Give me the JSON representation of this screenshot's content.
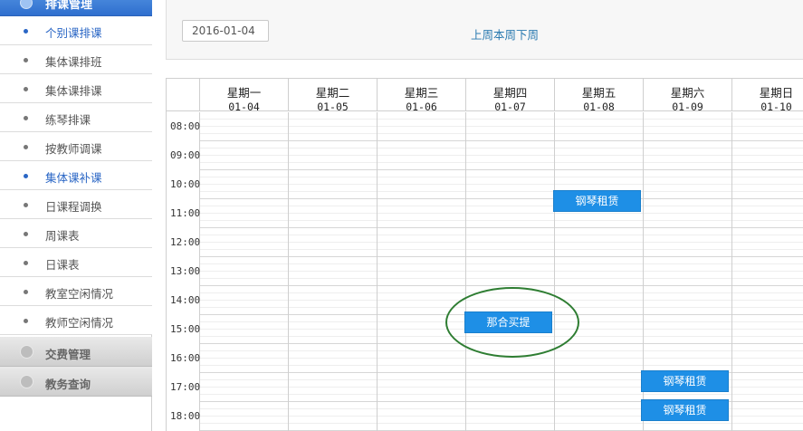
{
  "sidebar": {
    "active_group": "排课管理",
    "items": [
      {
        "label": "个别课排课",
        "color": "blue"
      },
      {
        "label": "集体课排班",
        "color": "gray"
      },
      {
        "label": "集体课排课",
        "color": "gray"
      },
      {
        "label": "练琴排课",
        "color": "gray"
      },
      {
        "label": "按教师调课",
        "color": "gray"
      },
      {
        "label": "集体课补课",
        "color": "blue"
      },
      {
        "label": "日课程调换",
        "color": "gray"
      },
      {
        "label": "周课表",
        "color": "gray"
      },
      {
        "label": "日课表",
        "color": "gray"
      },
      {
        "label": "教室空闲情况",
        "color": "gray"
      },
      {
        "label": "教师空闲情况",
        "color": "gray"
      }
    ],
    "sections": [
      {
        "label": "交费管理"
      },
      {
        "label": "教务查询"
      }
    ]
  },
  "toolbar": {
    "date_value": "2016-01-04",
    "nav_prev": "上周",
    "nav_current": "本周",
    "nav_next": "下周"
  },
  "calendar": {
    "days": [
      {
        "weekday": "星期一",
        "date": "01-04"
      },
      {
        "weekday": "星期二",
        "date": "01-05"
      },
      {
        "weekday": "星期三",
        "date": "01-06"
      },
      {
        "weekday": "星期四",
        "date": "01-07"
      },
      {
        "weekday": "星期五",
        "date": "01-08"
      },
      {
        "weekday": "星期六",
        "date": "01-09"
      },
      {
        "weekday": "星期日",
        "date": "01-10"
      }
    ],
    "hours": [
      "08:00",
      "09:00",
      "10:00",
      "11:00",
      "12:00",
      "13:00",
      "14:00",
      "15:00",
      "16:00",
      "17:00",
      "18:00"
    ],
    "events": [
      {
        "label": "钢琴租赁",
        "day": "星期五"
      },
      {
        "label": "那合买提",
        "day": "星期四"
      },
      {
        "label": "钢琴租赁",
        "day": "星期六"
      },
      {
        "label": "钢琴租赁",
        "day": "星期六"
      }
    ]
  },
  "colors": {
    "accent_blue": "#2f6fce",
    "event_blue": "#1e8fe6",
    "annotation_green": "#2e7d32"
  }
}
